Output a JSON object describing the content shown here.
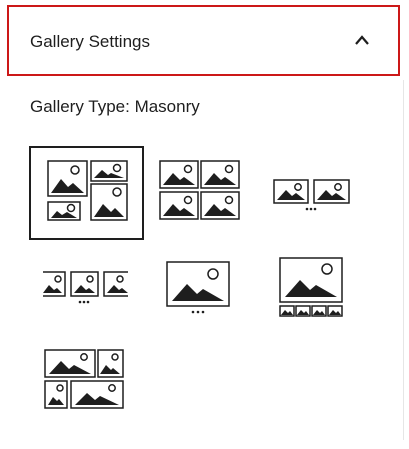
{
  "panel": {
    "header": {
      "title": "Gallery Settings",
      "toggle_icon": "chevron-up-icon"
    },
    "gallery_type_label": "Gallery Type: Masonry",
    "accent_color": "#cc1818",
    "options": [
      {
        "name": "masonry",
        "icon": "masonry-layout-icon",
        "selected": true
      },
      {
        "name": "grid",
        "icon": "grid-layout-icon",
        "selected": false
      },
      {
        "name": "carousel",
        "icon": "carousel-layout-icon",
        "selected": false
      },
      {
        "name": "slider-carousel",
        "icon": "multi-slide-carousel-icon",
        "selected": false
      },
      {
        "name": "slideshow",
        "icon": "slideshow-icon",
        "selected": false
      },
      {
        "name": "slideshow-thumbnails",
        "icon": "slideshow-thumbnails-icon",
        "selected": false
      },
      {
        "name": "justified",
        "icon": "justified-layout-icon",
        "selected": false
      }
    ]
  }
}
